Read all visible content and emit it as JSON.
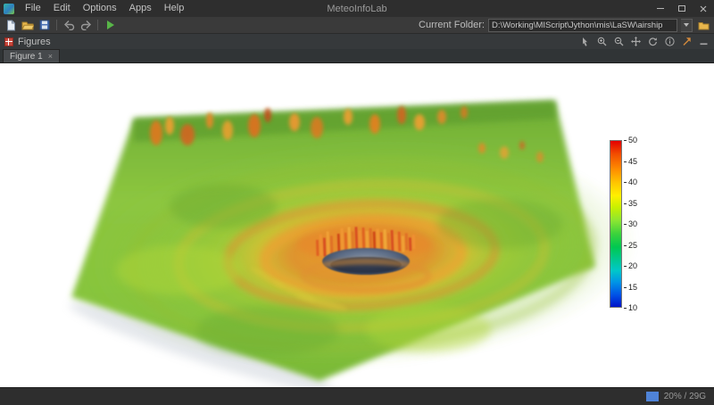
{
  "window": {
    "title": "MeteoInfoLab",
    "menus": [
      "File",
      "Edit",
      "Options",
      "Apps",
      "Help"
    ]
  },
  "toolbar": {
    "icons": [
      "new-script-icon",
      "open-icon",
      "save-icon",
      "undo-icon",
      "redo-icon",
      "run-icon"
    ],
    "current_folder_label": "Current Folder:",
    "current_folder_value": "D:\\Working\\MIScript\\Jython\\mis\\LaSW\\airship"
  },
  "figures": {
    "panel_title": "Figures",
    "tab_label": "Figure 1",
    "tab_close": "×",
    "tool_icons": [
      "select-arrow-icon",
      "zoom-in-icon",
      "zoom-out-icon",
      "pan-icon",
      "rotate-icon",
      "info-icon",
      "float-icon",
      "minimize-panel-icon"
    ]
  },
  "chart_data": {
    "type": "heatmap",
    "title": "",
    "description_visible": "3D volume rendering of a cyclone-like field with central eye",
    "colorbar_ticks": [
      50,
      45,
      40,
      35,
      30,
      25,
      20,
      15,
      10
    ],
    "colorbar_range": [
      10,
      50
    ],
    "legend_position": "right"
  },
  "colorbar": {
    "ticks": [
      "50",
      "45",
      "40",
      "35",
      "30",
      "25",
      "20",
      "15",
      "10"
    ],
    "colors_top_to_bottom": [
      "#e40000",
      "#ff8c00",
      "#ffc400",
      "#fff000",
      "#8ce632",
      "#3cd23c",
      "#00c850",
      "#00c8c8",
      "#0050e6",
      "#0014c8"
    ]
  },
  "statusbar": {
    "memory": "20% / 29G"
  }
}
